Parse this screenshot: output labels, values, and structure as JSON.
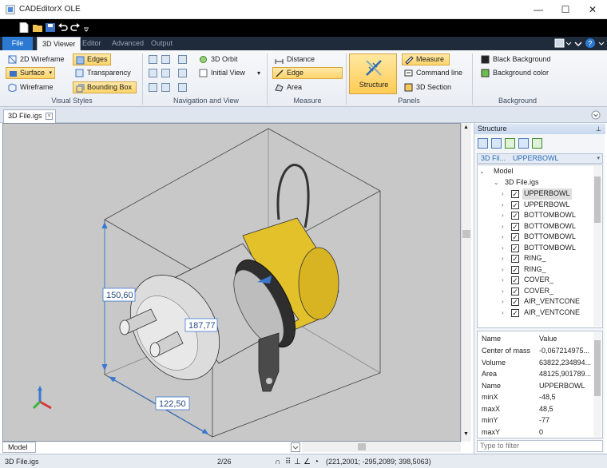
{
  "window": {
    "title": "CADEditorX OLE",
    "minimize": "—",
    "maximize": "☐",
    "close": "✕"
  },
  "tabs": {
    "file": "File",
    "items": [
      "3D Viewer",
      "Editor",
      "Advanced",
      "Output"
    ]
  },
  "ribbon": {
    "visual_styles": {
      "label": "Visual Styles",
      "wireframe_2d": "2D Wireframe",
      "surface": "Surface",
      "wireframe": "Wireframe",
      "edges": "Edges",
      "transparency": "Transparency",
      "bounding_box": "Bounding Box"
    },
    "navigation": {
      "label": "Navigation and View",
      "orbit": "3D Orbit",
      "initial_view": "Initial View"
    },
    "measure": {
      "label": "Measure",
      "distance": "Distance",
      "edge": "Edge",
      "area": "Area"
    },
    "panels": {
      "label": "Panels",
      "structure": "Structure",
      "measure": "Measure",
      "command_line": "Command line",
      "section": "3D Section"
    },
    "background": {
      "label": "Background",
      "black": "Black Background",
      "color": "Background color"
    }
  },
  "document": {
    "tab": "3D File.igs",
    "model_tab": "Model"
  },
  "viewport": {
    "dim_height": "150,60",
    "dim_depth": "187,77",
    "dim_width": "122,50"
  },
  "structure_panel": {
    "title": "Structure",
    "crumb_root": "3D Fil...",
    "crumb_current": "UPPERBOWL",
    "tree": {
      "model": "Model",
      "file": "3D File.igs",
      "items": [
        "UPPERBOWL",
        "UPPERBOWL",
        "BOTTOMBOWL",
        "BOTTOMBOWL",
        "BOTTOMBOWL",
        "BOTTOMBOWL",
        "RING_",
        "RING_",
        "COVER_",
        "COVER_",
        "AIR_VENTCONE",
        "AIR_VENTCONE"
      ]
    },
    "properties": {
      "header_name": "Name",
      "header_value": "Value",
      "rows": [
        {
          "name": "Center of mass",
          "value": "-0,067214975..."
        },
        {
          "name": "Volume",
          "value": "63822,234894..."
        },
        {
          "name": "Area",
          "value": "48125,901789..."
        },
        {
          "name": "Name",
          "value": "UPPERBOWL"
        },
        {
          "name": "minX",
          "value": "-48,5"
        },
        {
          "name": "maxX",
          "value": "48,5"
        },
        {
          "name": "minY",
          "value": "-77"
        },
        {
          "name": "maxY",
          "value": "0"
        }
      ]
    },
    "filter_placeholder": "Type to filter"
  },
  "status": {
    "file": "3D File.igs",
    "page": "2/26",
    "coords": "(221,2001; -295,2089; 398,5063)"
  },
  "colors": {
    "accent": "#2b79d0",
    "selected": "#ffd46a",
    "dimension": "#2a4d82",
    "cap_yellow": "#e3c12a"
  }
}
